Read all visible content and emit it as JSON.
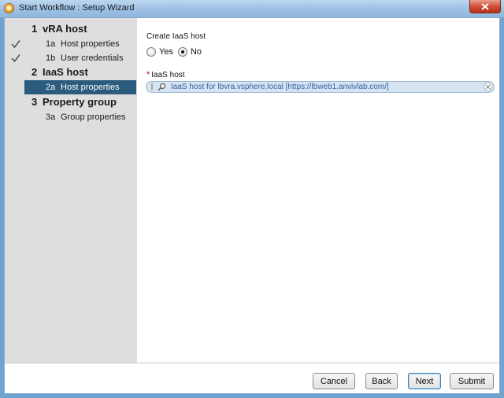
{
  "window": {
    "title": "Start Workflow : Setup Wizard"
  },
  "sidebar": {
    "steps": [
      {
        "num": "1",
        "label": "vRA host"
      },
      {
        "num": "1a",
        "label": "Host properties"
      },
      {
        "num": "1b",
        "label": "User credentials"
      },
      {
        "num": "2",
        "label": "IaaS host"
      },
      {
        "num": "2a",
        "label": "Host properties"
      },
      {
        "num": "3",
        "label": "Property group"
      },
      {
        "num": "3a",
        "label": "Group properties"
      }
    ]
  },
  "form": {
    "create_label": "Create IaaS host",
    "yes_label": "Yes",
    "no_label": "No",
    "selected": "No",
    "required_mark": "*",
    "host_label": "IaaS host",
    "host_value": "IaaS host for lbvra.vsphere.local [https://lbweb1.anvivlab.com/]"
  },
  "buttons": {
    "cancel": "Cancel",
    "back": "Back",
    "next": "Next",
    "submit": "Submit"
  },
  "colors": {
    "selected_step": "#2b5b7d",
    "chooser_bg": "#d6e3f1",
    "chooser_text": "#3562a8",
    "required": "#cc0000"
  }
}
